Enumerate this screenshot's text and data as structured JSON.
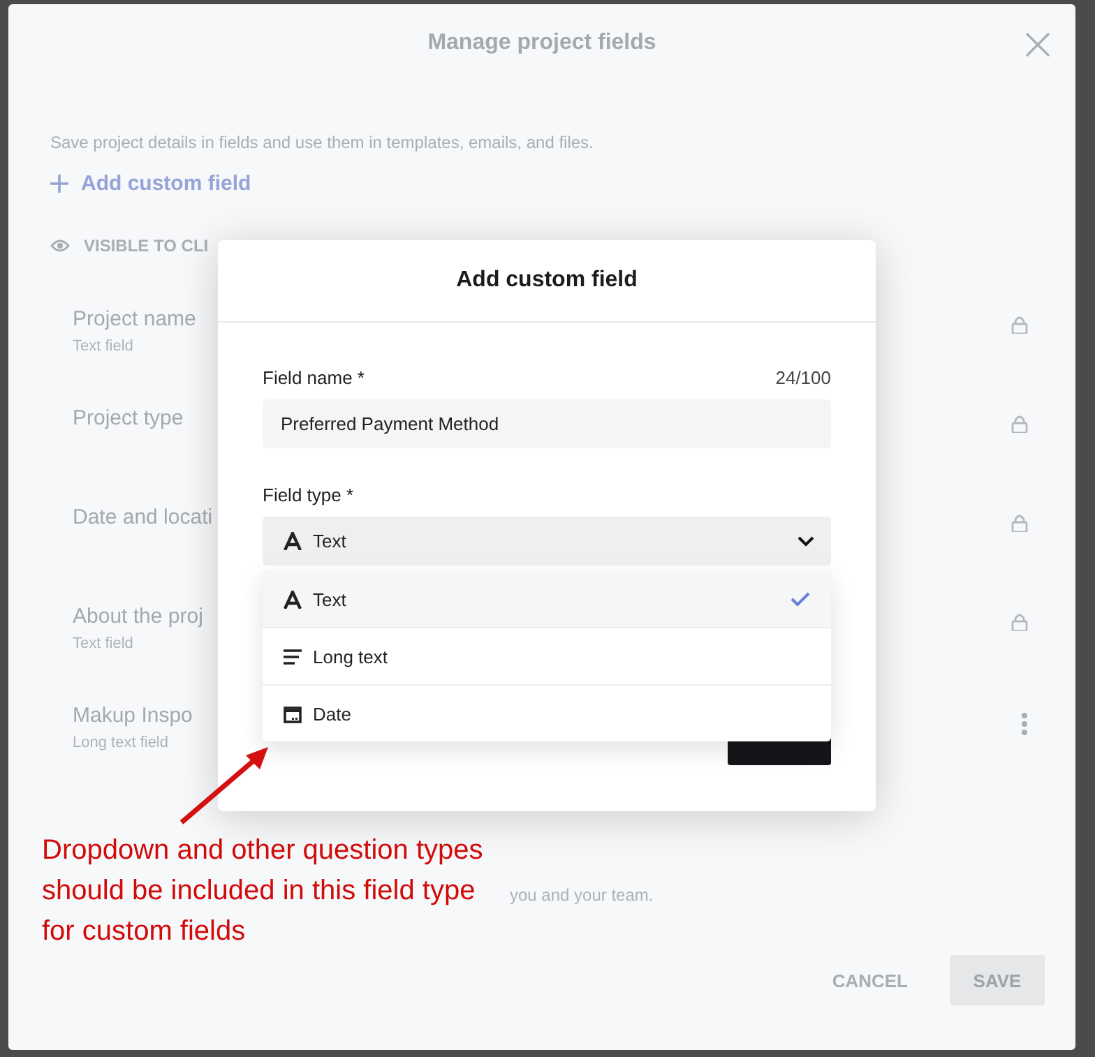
{
  "background_modal": {
    "title": "Manage project fields",
    "description": "Save project details in fields and use them in templates, emails, and files.",
    "add_link": "Add custom field",
    "section_label": "VISIBLE TO CLI",
    "fields": [
      {
        "name": "Project name",
        "type": "Text field",
        "kind": "locked"
      },
      {
        "name": "Project type",
        "kind": "locked"
      },
      {
        "name": "Date and locati",
        "kind": "locked"
      },
      {
        "name": "About the proj",
        "type": "Text field",
        "kind": "locked"
      },
      {
        "name": "Makup Inspo",
        "type": "Long text field",
        "kind": "menu"
      }
    ],
    "footer_note": "you and your team.",
    "cancel": "CANCEL",
    "save": "SAVE"
  },
  "dialog": {
    "title": "Add custom field",
    "field_name": {
      "label": "Field name *",
      "counter": "24/100",
      "value": "Preferred Payment Method"
    },
    "field_type": {
      "label": "Field type *",
      "value": "Text",
      "kind": "text"
    },
    "options": [
      {
        "label": "Text",
        "kind": "text",
        "selected": true
      },
      {
        "label": "Long text",
        "kind": "lines",
        "selected": false
      },
      {
        "label": "Date",
        "kind": "calendar",
        "selected": false
      }
    ]
  },
  "annotation": {
    "text": "Dropdown and other question types should be included in this field type for custom fields"
  }
}
